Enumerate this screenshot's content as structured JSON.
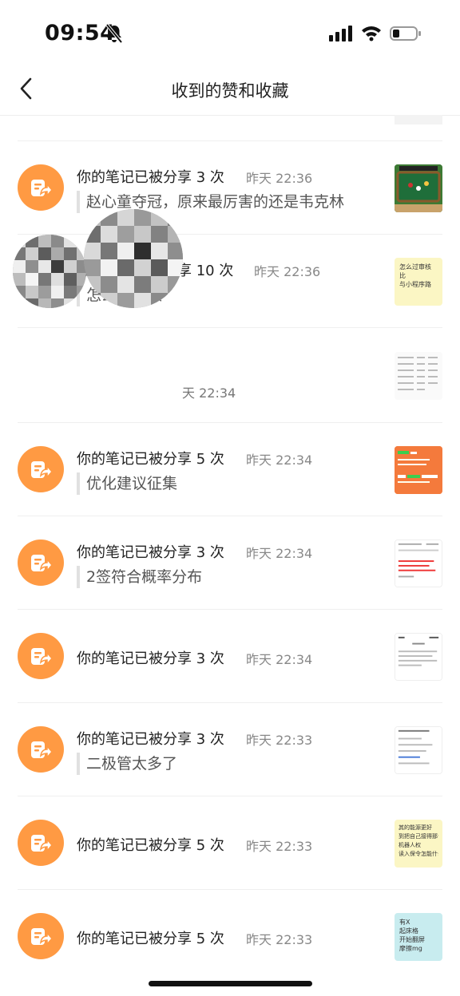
{
  "status": {
    "time": "09:54"
  },
  "header": {
    "title": "收到的赞和收藏"
  },
  "notifications": [
    {
      "title": "你的笔记已被分享 3 次",
      "time": "昨天 22:36",
      "quote": "赵心童夺冠，原来最厉害的还是韦克林",
      "thumb": "snooker-game"
    },
    {
      "title": "你的笔记已被分享 10 次",
      "time": "昨天 22:36",
      "quote": "怎么过审核",
      "thumb": "yellow-note",
      "thumb_lines": [
        "怎么过审核",
        "比",
        "与小程序路"
      ]
    },
    {
      "title": "",
      "time": "天 22:34",
      "quote": "",
      "thumb": "table-screenshot"
    },
    {
      "title": "你的笔记已被分享 5 次",
      "time": "昨天 22:34",
      "quote": "优化建议征集",
      "thumb": "orange-note"
    },
    {
      "title": "你的笔记已被分享 3 次",
      "time": "昨天 22:34",
      "quote": "2签符合概率分布",
      "thumb": "doc-screenshot-red"
    },
    {
      "title": "你的笔记已被分享 3 次",
      "time": "昨天 22:34",
      "quote": "",
      "thumb": "phone-screenshot"
    },
    {
      "title": "你的笔记已被分享 3 次",
      "time": "昨天 22:33",
      "quote": "二极管太多了",
      "thumb": "form-screenshot"
    },
    {
      "title": "你的笔记已被分享 5 次",
      "time": "昨天 22:33",
      "quote": "",
      "thumb": "yellow-note-2",
      "thumb_lines": [
        "其的能源更好",
        "到把自己接得那个",
        "机器人权",
        "读入保令怎能什么"
      ]
    },
    {
      "title": "你的笔记已被分享 5 次",
      "time": "昨天 22:33",
      "quote": "",
      "thumb": "cyan-note",
      "thumb_lines": [
        "有X",
        "起床格",
        "开始翻屏",
        "摩擦mg"
      ]
    }
  ],
  "colors": {
    "accent": "#ff9a43",
    "muted": "#888888",
    "divider": "#efefef"
  }
}
